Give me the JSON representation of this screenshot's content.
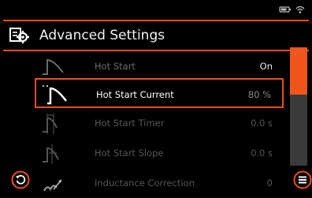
{
  "status": {
    "icons": [
      "battery-icon",
      "wifi-icon"
    ]
  },
  "header": {
    "title": "Advanced Settings",
    "icon": "settings-gear-icon"
  },
  "rows": [
    {
      "label": "Hot Start",
      "value": "On",
      "icon": "hot-start-icon"
    },
    {
      "label": "Hot Start Current",
      "value": "80 %",
      "icon": "hot-start-current-icon"
    },
    {
      "label": "Hot Start Timer",
      "value": "0.0 s",
      "icon": "hot-start-timer-icon"
    },
    {
      "label": "Hot Start Slope",
      "value": "0.0 s",
      "icon": "hot-start-slope-icon"
    },
    {
      "label": "Inductance Correction",
      "value": "0",
      "icon": "inductance-correction-icon"
    }
  ],
  "scroll": {
    "position": 0.0,
    "visible_fraction": 0.4
  },
  "colors": {
    "accent": "#e8501a",
    "background": "#000000",
    "text": "#ffffff",
    "dim_text": "#6d6d6d"
  },
  "controls": {
    "back": "back-icon",
    "menu": "menu-icon"
  }
}
